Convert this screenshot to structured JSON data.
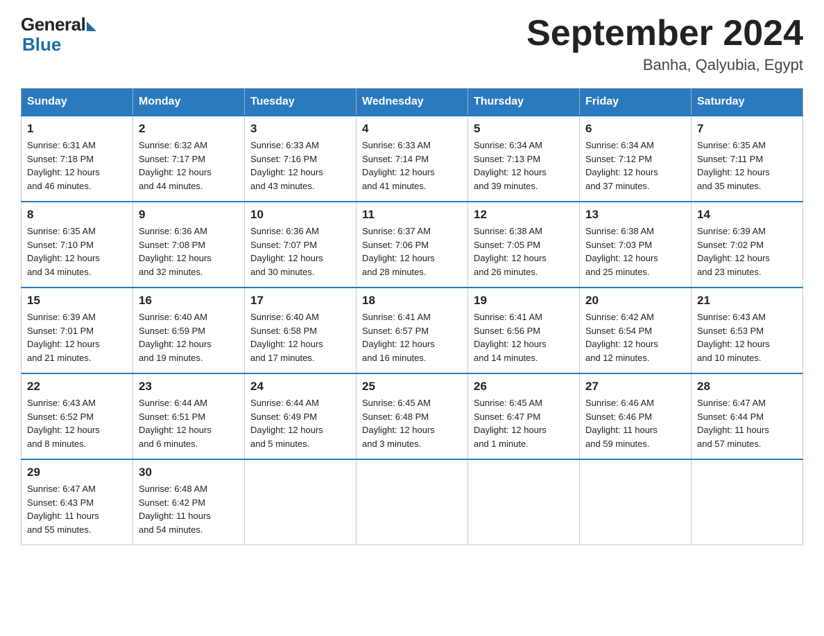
{
  "header": {
    "logo": {
      "general": "General",
      "blue": "Blue",
      "tagline": "Blue"
    },
    "title": "September 2024",
    "subtitle": "Banha, Qalyubia, Egypt"
  },
  "calendar": {
    "days_of_week": [
      "Sunday",
      "Monday",
      "Tuesday",
      "Wednesday",
      "Thursday",
      "Friday",
      "Saturday"
    ],
    "weeks": [
      [
        {
          "day": "1",
          "sunrise": "6:31 AM",
          "sunset": "7:18 PM",
          "daylight": "12 hours and 46 minutes."
        },
        {
          "day": "2",
          "sunrise": "6:32 AM",
          "sunset": "7:17 PM",
          "daylight": "12 hours and 44 minutes."
        },
        {
          "day": "3",
          "sunrise": "6:33 AM",
          "sunset": "7:16 PM",
          "daylight": "12 hours and 43 minutes."
        },
        {
          "day": "4",
          "sunrise": "6:33 AM",
          "sunset": "7:14 PM",
          "daylight": "12 hours and 41 minutes."
        },
        {
          "day": "5",
          "sunrise": "6:34 AM",
          "sunset": "7:13 PM",
          "daylight": "12 hours and 39 minutes."
        },
        {
          "day": "6",
          "sunrise": "6:34 AM",
          "sunset": "7:12 PM",
          "daylight": "12 hours and 37 minutes."
        },
        {
          "day": "7",
          "sunrise": "6:35 AM",
          "sunset": "7:11 PM",
          "daylight": "12 hours and 35 minutes."
        }
      ],
      [
        {
          "day": "8",
          "sunrise": "6:35 AM",
          "sunset": "7:10 PM",
          "daylight": "12 hours and 34 minutes."
        },
        {
          "day": "9",
          "sunrise": "6:36 AM",
          "sunset": "7:08 PM",
          "daylight": "12 hours and 32 minutes."
        },
        {
          "day": "10",
          "sunrise": "6:36 AM",
          "sunset": "7:07 PM",
          "daylight": "12 hours and 30 minutes."
        },
        {
          "day": "11",
          "sunrise": "6:37 AM",
          "sunset": "7:06 PM",
          "daylight": "12 hours and 28 minutes."
        },
        {
          "day": "12",
          "sunrise": "6:38 AM",
          "sunset": "7:05 PM",
          "daylight": "12 hours and 26 minutes."
        },
        {
          "day": "13",
          "sunrise": "6:38 AM",
          "sunset": "7:03 PM",
          "daylight": "12 hours and 25 minutes."
        },
        {
          "day": "14",
          "sunrise": "6:39 AM",
          "sunset": "7:02 PM",
          "daylight": "12 hours and 23 minutes."
        }
      ],
      [
        {
          "day": "15",
          "sunrise": "6:39 AM",
          "sunset": "7:01 PM",
          "daylight": "12 hours and 21 minutes."
        },
        {
          "day": "16",
          "sunrise": "6:40 AM",
          "sunset": "6:59 PM",
          "daylight": "12 hours and 19 minutes."
        },
        {
          "day": "17",
          "sunrise": "6:40 AM",
          "sunset": "6:58 PM",
          "daylight": "12 hours and 17 minutes."
        },
        {
          "day": "18",
          "sunrise": "6:41 AM",
          "sunset": "6:57 PM",
          "daylight": "12 hours and 16 minutes."
        },
        {
          "day": "19",
          "sunrise": "6:41 AM",
          "sunset": "6:56 PM",
          "daylight": "12 hours and 14 minutes."
        },
        {
          "day": "20",
          "sunrise": "6:42 AM",
          "sunset": "6:54 PM",
          "daylight": "12 hours and 12 minutes."
        },
        {
          "day": "21",
          "sunrise": "6:43 AM",
          "sunset": "6:53 PM",
          "daylight": "12 hours and 10 minutes."
        }
      ],
      [
        {
          "day": "22",
          "sunrise": "6:43 AM",
          "sunset": "6:52 PM",
          "daylight": "12 hours and 8 minutes."
        },
        {
          "day": "23",
          "sunrise": "6:44 AM",
          "sunset": "6:51 PM",
          "daylight": "12 hours and 6 minutes."
        },
        {
          "day": "24",
          "sunrise": "6:44 AM",
          "sunset": "6:49 PM",
          "daylight": "12 hours and 5 minutes."
        },
        {
          "day": "25",
          "sunrise": "6:45 AM",
          "sunset": "6:48 PM",
          "daylight": "12 hours and 3 minutes."
        },
        {
          "day": "26",
          "sunrise": "6:45 AM",
          "sunset": "6:47 PM",
          "daylight": "12 hours and 1 minute."
        },
        {
          "day": "27",
          "sunrise": "6:46 AM",
          "sunset": "6:46 PM",
          "daylight": "11 hours and 59 minutes."
        },
        {
          "day": "28",
          "sunrise": "6:47 AM",
          "sunset": "6:44 PM",
          "daylight": "11 hours and 57 minutes."
        }
      ],
      [
        {
          "day": "29",
          "sunrise": "6:47 AM",
          "sunset": "6:43 PM",
          "daylight": "11 hours and 55 minutes."
        },
        {
          "day": "30",
          "sunrise": "6:48 AM",
          "sunset": "6:42 PM",
          "daylight": "11 hours and 54 minutes."
        },
        null,
        null,
        null,
        null,
        null
      ]
    ],
    "labels": {
      "sunrise": "Sunrise:",
      "sunset": "Sunset:",
      "daylight": "Daylight:"
    }
  }
}
